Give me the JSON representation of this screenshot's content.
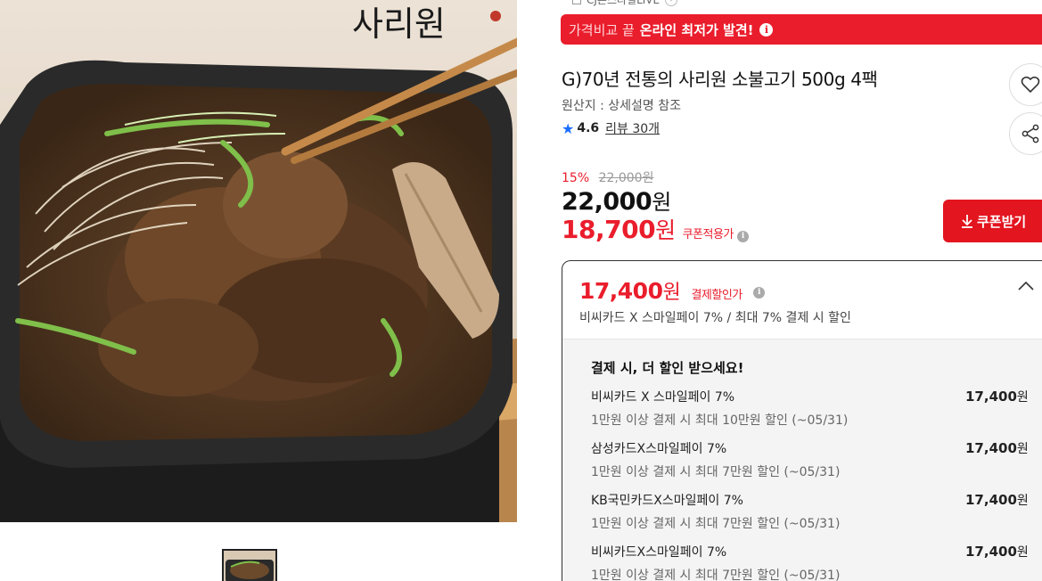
{
  "store": {
    "label": "CJ온스타일LIVE"
  },
  "promo_banner": {
    "prefix": "가격비교 끝",
    "highlight": "온라인 최저가 발견!",
    "info_icon": "i"
  },
  "product": {
    "title": "G)70년 전통의 사리원 소불고기 500g 4팩",
    "origin": "원산지 : 상세설명 참조",
    "rating": "4.6",
    "reviews": "리뷰 30개",
    "image_brand_text": "사리원",
    "icons": {
      "like": "heart-icon",
      "share": "share-icon",
      "star": "star-icon"
    }
  },
  "price": {
    "discount_rate": "15%",
    "original_price": "22,000원",
    "sale_price_number": "22,000",
    "sale_price_unit": "원",
    "coupon_price_number": "18,700",
    "coupon_price_unit": "원",
    "coupon_price_label": "쿠폰적용가"
  },
  "coupon_button": {
    "label": "쿠폰받기"
  },
  "payment": {
    "price_number": "17,400",
    "price_unit": "원",
    "price_label": "결제할인가",
    "summary": "비씨카드 X 스마일페이 7% / 최대 7% 결제 시 할인",
    "heading": "결제 시, 더 할인 받으세요!",
    "offers": [
      {
        "name": "비씨카드 X 스마일페이 7%",
        "desc": "1만원 이상 결제 시 최대 10만원 할인 (~05/31)",
        "amount": "17,400",
        "unit": "원"
      },
      {
        "name": "삼성카드X스마일페이 7%",
        "desc": "1만원 이상 결제 시 최대 7만원 할인 (~05/31)",
        "amount": "17,400",
        "unit": "원"
      },
      {
        "name": "KB국민카드X스마일페이 7%",
        "desc": "1만원 이상 결제 시 최대 7만원 할인 (~05/31)",
        "amount": "17,400",
        "unit": "원"
      },
      {
        "name": "비씨카드X스마일페이 7%",
        "desc": "1만원 이상 결제 시 최대 7만원 할인 (~05/31)",
        "amount": "17,400",
        "unit": "원"
      }
    ]
  },
  "colors": {
    "accent_red": "#ea1d2c",
    "star_blue": "#1a6dff"
  }
}
